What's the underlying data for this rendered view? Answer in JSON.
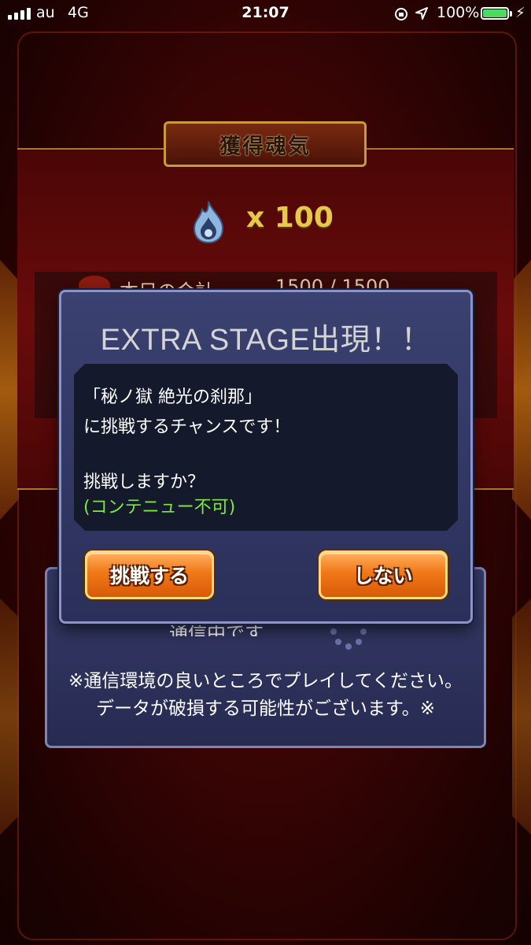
{
  "status_bar": {
    "carrier": "au",
    "network": "4G",
    "time": "21:07",
    "battery": "100%",
    "icons": [
      "signal-icon",
      "rotation-lock-icon",
      "location-icon",
      "battery-icon",
      "charging-bolt-icon"
    ]
  },
  "result": {
    "title": "獲得魂気",
    "soul_count": "x 100",
    "daily_label": "本日の合計",
    "daily_value": "1500 / 1500"
  },
  "comm": {
    "status": "通信中です",
    "note_line1": "※通信環境の良いところでプレイしてください。",
    "note_line2": "データが破損する可能性がございます。※"
  },
  "modal": {
    "title": "EXTRA STAGE出現！！",
    "line1": "「秘ノ獄 絶光の刹那」",
    "line2": "に挑戦するチャンスです！",
    "line3": "挑戦しますか？",
    "line4": "(コンテニュー不可)",
    "yes_label": "挑戦する",
    "no_label": "しない"
  },
  "colors": {
    "accent_gold": "#e8c84a",
    "warning_green": "#7ce840",
    "button_orange": "#f07818",
    "panel_navy": "#2b305a"
  }
}
